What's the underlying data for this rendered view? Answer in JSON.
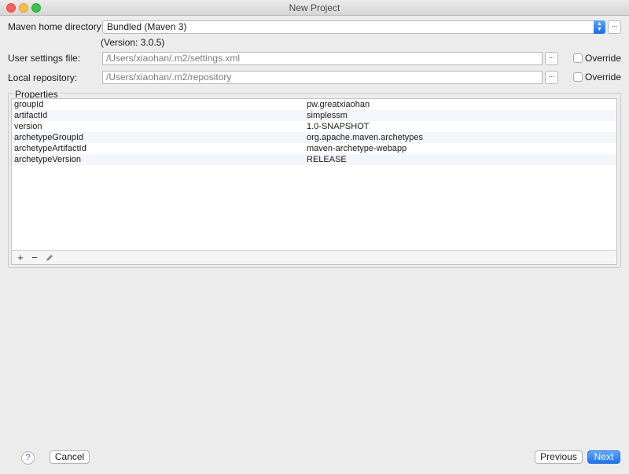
{
  "window": {
    "title": "New Project"
  },
  "maven_home": {
    "label": "Maven home directory:",
    "value": "Bundled (Maven 3)",
    "browse_label": "...",
    "version": "(Version: 3.0.5)"
  },
  "user_settings": {
    "label": "User settings file:",
    "value": "/Users/xiaohan/.m2/settings.xml",
    "browse_label": "...",
    "override_label": "Override",
    "override_checked": false
  },
  "local_repository": {
    "label": "Local repository:",
    "value": "/Users/xiaohan/.m2/repository",
    "browse_label": "...",
    "override_label": "Override",
    "override_checked": false
  },
  "properties": {
    "title": "Properties",
    "rows": [
      {
        "key": "groupId",
        "value": "pw.greatxiaohan"
      },
      {
        "key": "artifactId",
        "value": "simplessm"
      },
      {
        "key": "version",
        "value": "1.0-SNAPSHOT"
      },
      {
        "key": "archetypeGroupId",
        "value": "org.apache.maven.archetypes"
      },
      {
        "key": "archetypeArtifactId",
        "value": "maven-archetype-webapp"
      },
      {
        "key": "archetypeVersion",
        "value": "RELEASE"
      }
    ],
    "toolbar": {
      "add_icon": "plus-icon",
      "remove_icon": "minus-icon",
      "edit_icon": "pencil-icon"
    }
  },
  "footer": {
    "help_label": "?",
    "cancel_label": "Cancel",
    "previous_label": "Previous",
    "next_label": "Next"
  },
  "colors": {
    "accent": "#1d73f0",
    "close": "#fc605c",
    "minimize": "#fdbd41",
    "maximize": "#34c84a"
  }
}
